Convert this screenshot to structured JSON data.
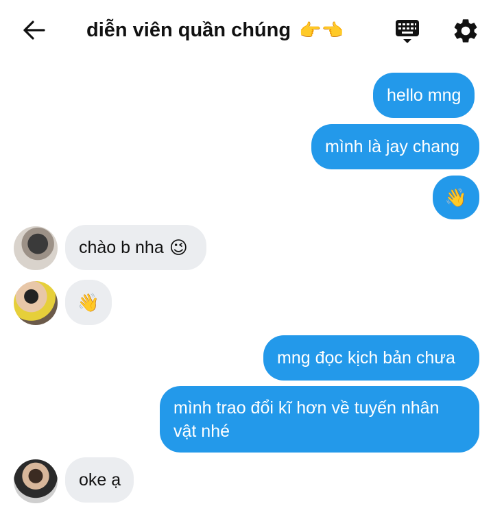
{
  "header": {
    "title": "diễn viên quần chúng",
    "title_emoji": "👉👈"
  },
  "icons": {
    "back": "arrow-left-icon",
    "keyboard": "keyboard-icon",
    "settings": "gear-icon"
  },
  "colors": {
    "outgoing_bubble": "#2399ea",
    "incoming_bubble": "#ebedf0"
  },
  "messages": [
    {
      "side": "out",
      "text": "hello mng"
    },
    {
      "side": "out",
      "text": "mình là jay chang"
    },
    {
      "side": "out",
      "text": "👋"
    },
    {
      "side": "in",
      "text": "chào b nha",
      "emoji": "😉"
    },
    {
      "side": "in",
      "text": "👋"
    },
    {
      "side": "out",
      "text": "mng đọc kịch bản chưa"
    },
    {
      "side": "out",
      "line1": "mình trao đổi kĩ hơn về tuyến nhân",
      "line2": "vật nhé"
    },
    {
      "side": "in",
      "text": "oke ạ"
    }
  ]
}
